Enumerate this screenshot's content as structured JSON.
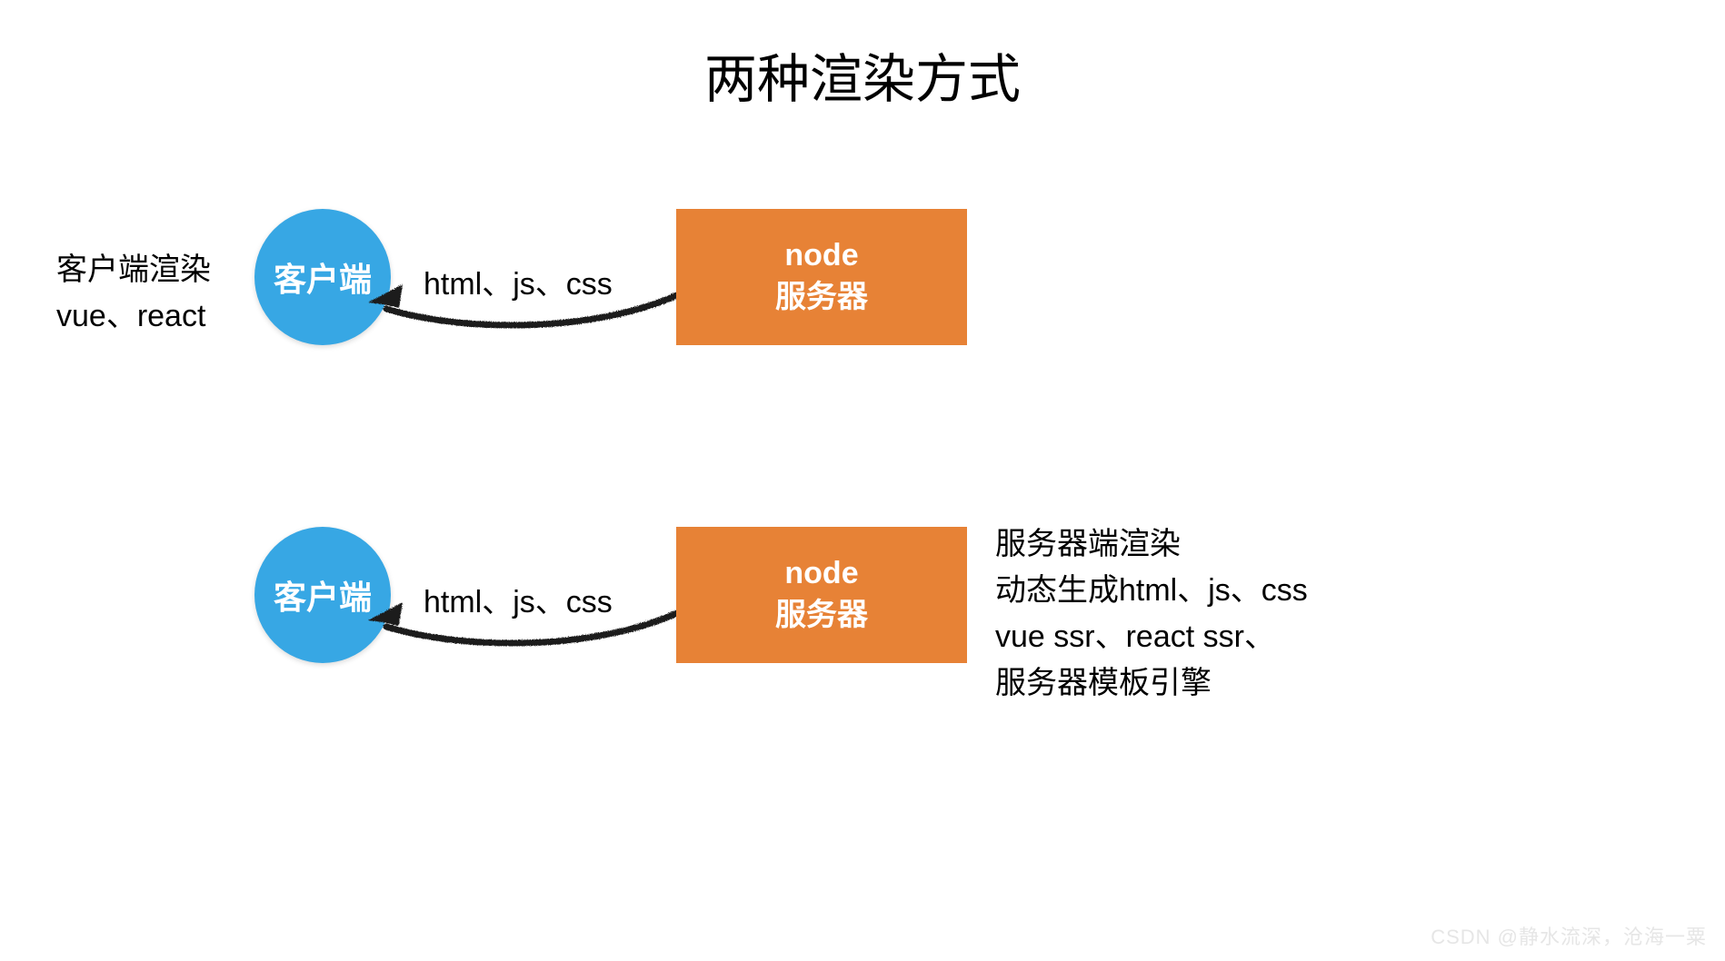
{
  "title": "两种渲染方式",
  "rows": [
    {
      "client_label": "客户端",
      "arrow_label": "html、js、css",
      "server_line1": "node",
      "server_line2": "服务器",
      "side": {
        "position": "left",
        "line1": "客户端渲染",
        "line2": "vue、react"
      }
    },
    {
      "client_label": "客户端",
      "arrow_label": "html、js、css",
      "server_line1": "node",
      "server_line2": "服务器",
      "side": {
        "position": "right",
        "line1": "服务器端渲染",
        "line2": "动态生成html、js、css",
        "line3": "vue ssr、react ssr、",
        "line4": "服务器模板引擎"
      }
    }
  ],
  "colors": {
    "client": "#37a7e4",
    "server": "#e78236",
    "arrow": "#1a1a1a"
  },
  "watermark": "CSDN @静水流深，沧海一粟"
}
